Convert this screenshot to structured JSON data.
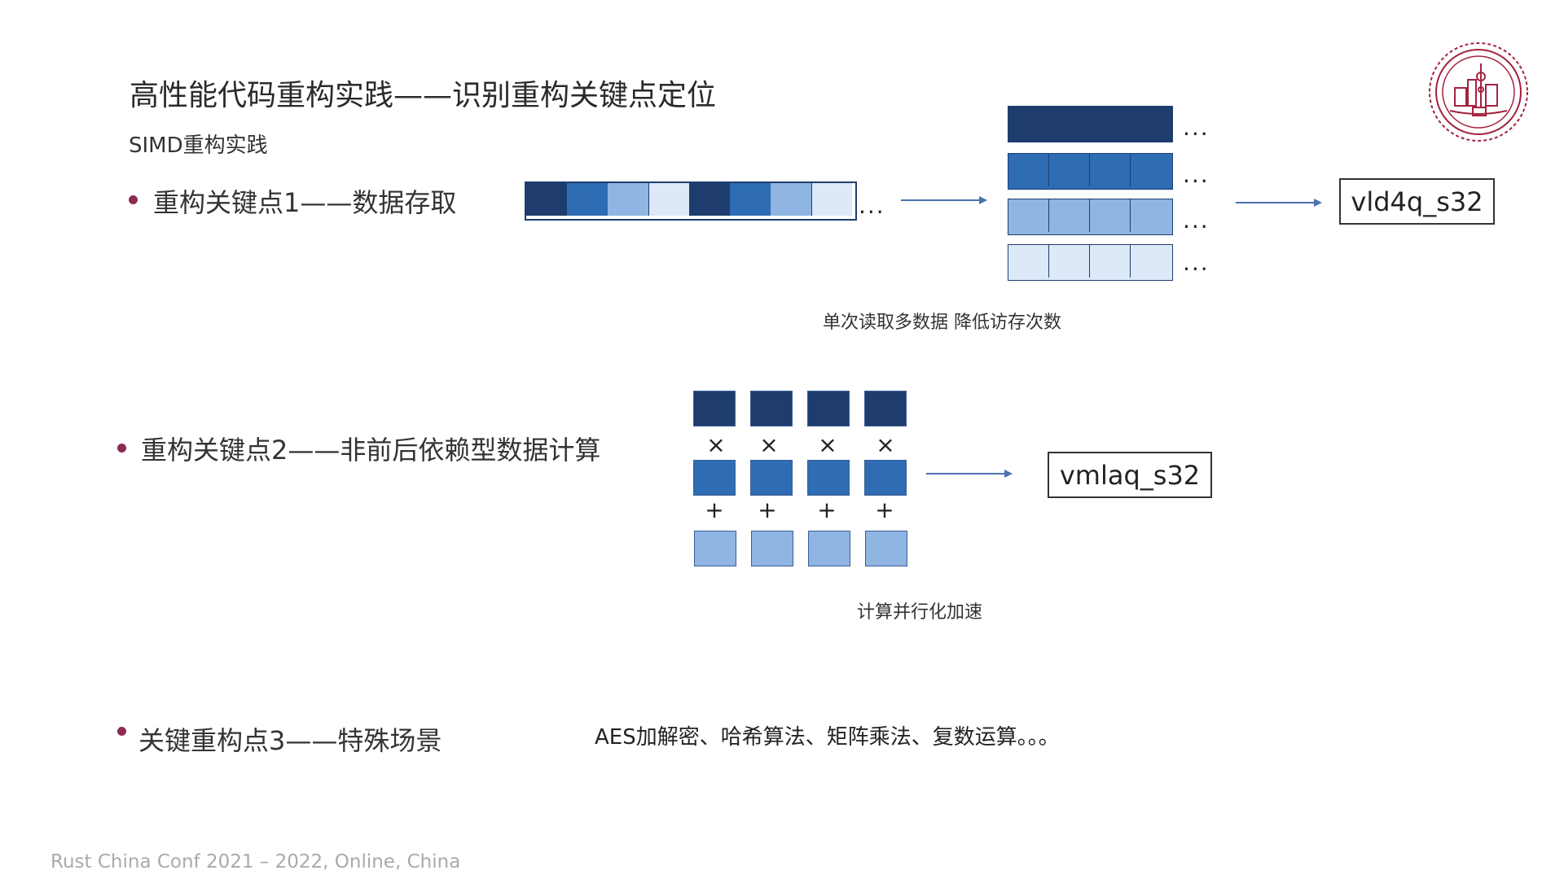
{
  "slide": {
    "title": "高性能代码重构实践——识别重构关键点定位",
    "subtitle": "SIMD重构实践",
    "footer": "Rust China Conf 2021 – 2022, Online, China"
  },
  "point1": {
    "label": "重构关键点1——数据存取",
    "ellipsis": "...",
    "caption": "单次读取多数据 降低访存次数",
    "instruction": "vld4q_s32"
  },
  "point2": {
    "label": "重构关键点2——非前后依赖型数据计算",
    "mul_op": "×",
    "add_op": "+",
    "caption": "计算并行化加速",
    "instruction": "vmlaq_s32"
  },
  "point3": {
    "label": "关键重构点3——特殊场景",
    "examples": "AES加解密、哈希算法、矩阵乘法、复数运算。。。"
  },
  "colors": {
    "dark_blue": "#1e3d6e",
    "mid_blue": "#2e6db4",
    "light_blue": "#8fb5e3",
    "pale_blue": "#dde9f8",
    "bullet": "#8e2a55",
    "logo": "#a3233f"
  },
  "logo": {
    "icon": "university-seal-icon"
  }
}
